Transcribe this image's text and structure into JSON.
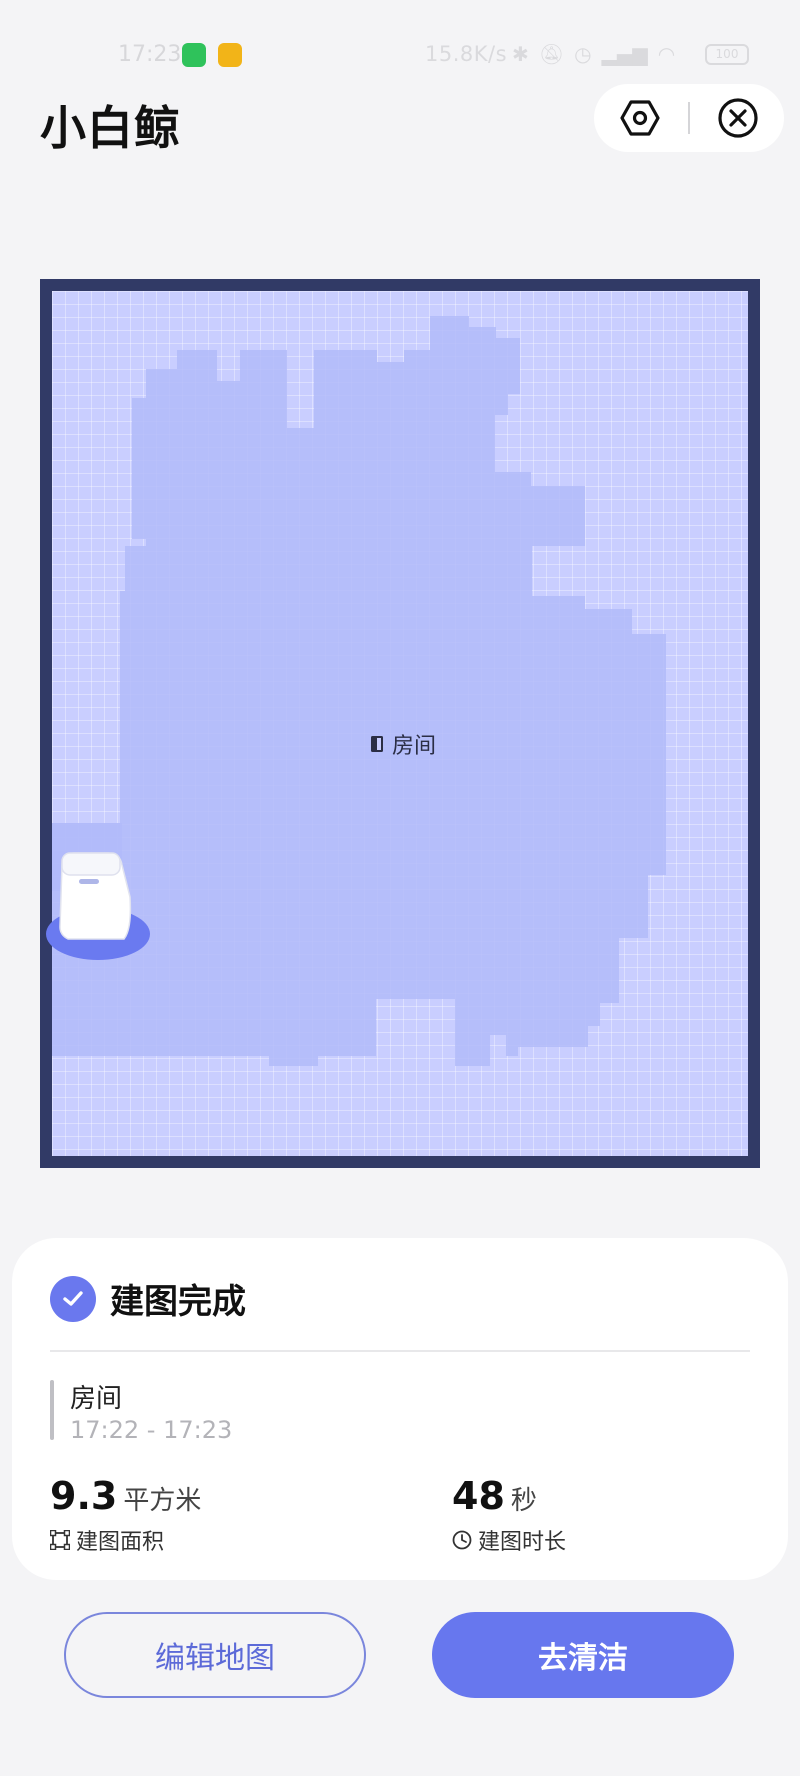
{
  "status_bar": {
    "time": "17:23",
    "network_speed": "15.8K/s",
    "battery": "100"
  },
  "header": {
    "title": "小白鲸"
  },
  "map": {
    "room_label": "房间"
  },
  "result_card": {
    "title": "建图完成",
    "room_name": "房间",
    "time_range": "17:22 - 17:23",
    "area_value": "9.3",
    "area_unit": "平方米",
    "area_label": "建图面积",
    "duration_value": "48",
    "duration_unit": "秒",
    "duration_label": "建图时长"
  },
  "actions": {
    "edit_label": "编辑地图",
    "clean_label": "去清洁"
  },
  "colors": {
    "accent": "#6777ee",
    "map_border": "#313a66",
    "map_floor": "#b1bbf9",
    "map_unexplored": "#c9ceff"
  }
}
